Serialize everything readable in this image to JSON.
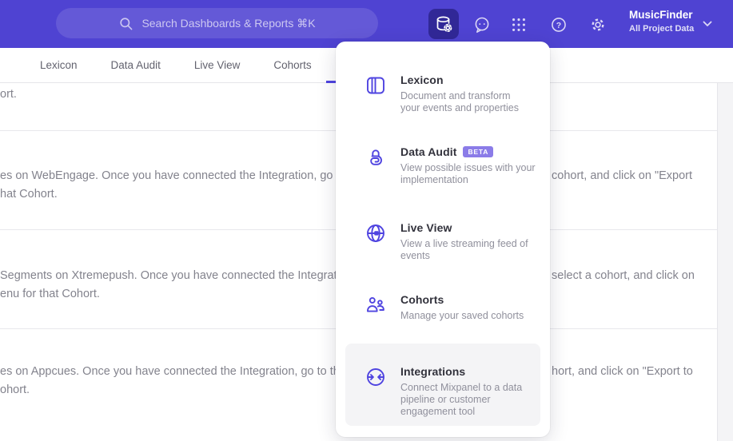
{
  "topbar": {
    "search_placeholder": "Search Dashboards & Reports ⌘K",
    "project_name": "MusicFinder",
    "project_scope": "All Project Data",
    "icons": [
      "search-icon",
      "data-management-icon",
      "feedback-icon",
      "apps-grid-icon",
      "help-icon",
      "settings-icon",
      "chevron-down-icon"
    ]
  },
  "nav": {
    "tabs": [
      "Lexicon",
      "Data Audit",
      "Live View",
      "Cohorts"
    ]
  },
  "content": {
    "rows": [
      {
        "left_text": "ort.",
        "right_fragment": ""
      },
      {
        "left_text": "es on WebEngage. Once you have connected the Integration, go to the\nhat Cohort.",
        "right_fragment": "cohort, and click on \"Export"
      },
      {
        "left_text": "Segments on Xtremepush. Once you have connected the Integration,\nenu for that Cohort.",
        "right_fragment": "select a cohort, and click on"
      },
      {
        "left_text": "es on Appcues. Once you have connected the Integration, go to the M\nohort.",
        "right_fragment": "hort, and click on \"Export to"
      }
    ]
  },
  "menu": {
    "items": [
      {
        "title": "Lexicon",
        "icon": "lexicon-book-icon",
        "desc": "Document and transform\nyour events and properties"
      },
      {
        "title": "Data Audit",
        "badge": "BETA",
        "icon": "data-audit-lock-icon",
        "desc": "View possible issues with your\nimplementation"
      },
      {
        "title": "Live View",
        "icon": "live-view-globe-icon",
        "desc": "View a live streaming feed of\nevents"
      },
      {
        "title": "Cohorts",
        "icon": "cohorts-people-icon",
        "desc": "Manage your saved cohorts"
      },
      {
        "title": "Integrations",
        "icon": "integrations-sync-icon",
        "desc": "Connect Mixpanel to a data\npipeline or customer\nengagement tool",
        "highlighted": true
      }
    ]
  },
  "colors": {
    "topbar": "#4f43d2",
    "accent": "#4f44e0",
    "badge": "#8b7ce8",
    "highlight": "#f4f4f6",
    "body_text": "#83838d"
  }
}
